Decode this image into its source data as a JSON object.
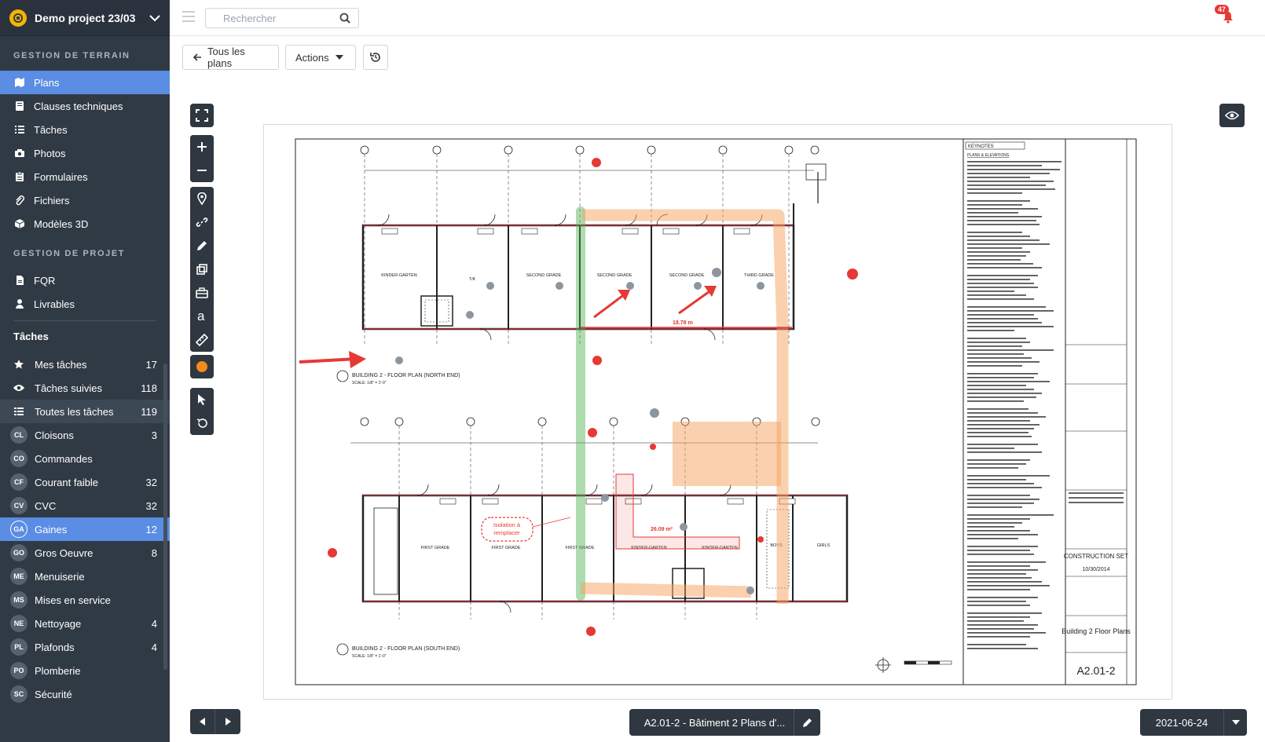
{
  "sidebar": {
    "project_name": "Demo project 23/03",
    "section_field": "GESTION DE TERRAIN",
    "field_items": [
      {
        "label": "Plans",
        "icon": "map-icon"
      },
      {
        "label": "Clauses techniques",
        "icon": "book-icon"
      },
      {
        "label": "Tâches",
        "icon": "list-icon"
      },
      {
        "label": "Photos",
        "icon": "camera-icon"
      },
      {
        "label": "Formulaires",
        "icon": "clipboard-icon"
      },
      {
        "label": "Fichiers",
        "icon": "paperclip-icon"
      },
      {
        "label": "Modèles 3D",
        "icon": "cube-icon"
      }
    ],
    "section_project": "GESTION DE PROJET",
    "project_items": [
      {
        "label": "FQR",
        "icon": "document-icon"
      },
      {
        "label": "Livrables",
        "icon": "user-icon"
      }
    ],
    "tasks_title": "Tâches",
    "task_items": [
      {
        "label": "Mes tâches",
        "count": "17",
        "icon": "star-icon"
      },
      {
        "label": "Tâches suivies",
        "count": "118",
        "icon": "eye-icon"
      },
      {
        "label": "Toutes les tâches",
        "count": "119",
        "icon": "grid-icon"
      },
      {
        "label": "Cloisons",
        "count": "3",
        "abbr": "CL"
      },
      {
        "label": "Commandes",
        "count": "",
        "abbr": "CO"
      },
      {
        "label": "Courant faible",
        "count": "32",
        "abbr": "CF"
      },
      {
        "label": "CVC",
        "count": "32",
        "abbr": "CV"
      },
      {
        "label": "Gaines",
        "count": "12",
        "abbr": "GA"
      },
      {
        "label": "Gros Oeuvre",
        "count": "8",
        "abbr": "GO"
      },
      {
        "label": "Menuiserie",
        "count": "",
        "abbr": "ME"
      },
      {
        "label": "Mises en service",
        "count": "",
        "abbr": "MS"
      },
      {
        "label": "Nettoyage",
        "count": "4",
        "abbr": "NE"
      },
      {
        "label": "Plafonds",
        "count": "4",
        "abbr": "PL"
      },
      {
        "label": "Plomberie",
        "count": "",
        "abbr": "PO"
      },
      {
        "label": "Sécurité",
        "count": "",
        "abbr": "SC"
      }
    ]
  },
  "topbar": {
    "search_placeholder": "Rechercher",
    "notification_count": "47"
  },
  "toolbar": {
    "back_label": "Tous les plans",
    "actions_label": "Actions"
  },
  "viewer": {
    "sheet_label": "A2.01-2 - Bâtiment 2 Plans d'...",
    "date": "2021-06-24"
  },
  "plan": {
    "title_north": "BUILDING 2 - FLOOR PLAN (NORTH END)",
    "title_south": "BUILDING 2 - FLOOR PLAN (SOUTH END)",
    "scale": "SCALE: 1/8\" = 1'-0\"",
    "annotation_text_1": "Isolation à",
    "annotation_text_2": "remplacer",
    "measure_length": "18.78 m",
    "measure_area": "26.09 m²",
    "keynotes_title": "KEYNOTES",
    "keynotes_sub": "PLANS & ELEVATIONS",
    "title_block_set": "CONSTRUCTION SET",
    "title_block_date": "10/30/2014",
    "title_block_name": "Building 2 Floor Plans",
    "sheet_number": "A2.01-2",
    "rooms_north": [
      "KINDER-GARTEN",
      "T/K",
      "SECOND GRADE",
      "SECOND GRADE",
      "SECOND GRADE",
      "THIRD GRADE"
    ],
    "rooms_south": [
      "FIRST GRADE",
      "FIRST GRADE",
      "FIRST GRADE",
      "KINDER-GARTEN",
      "KINDER-GARTEN",
      "BOYS",
      "GIRLS"
    ]
  }
}
